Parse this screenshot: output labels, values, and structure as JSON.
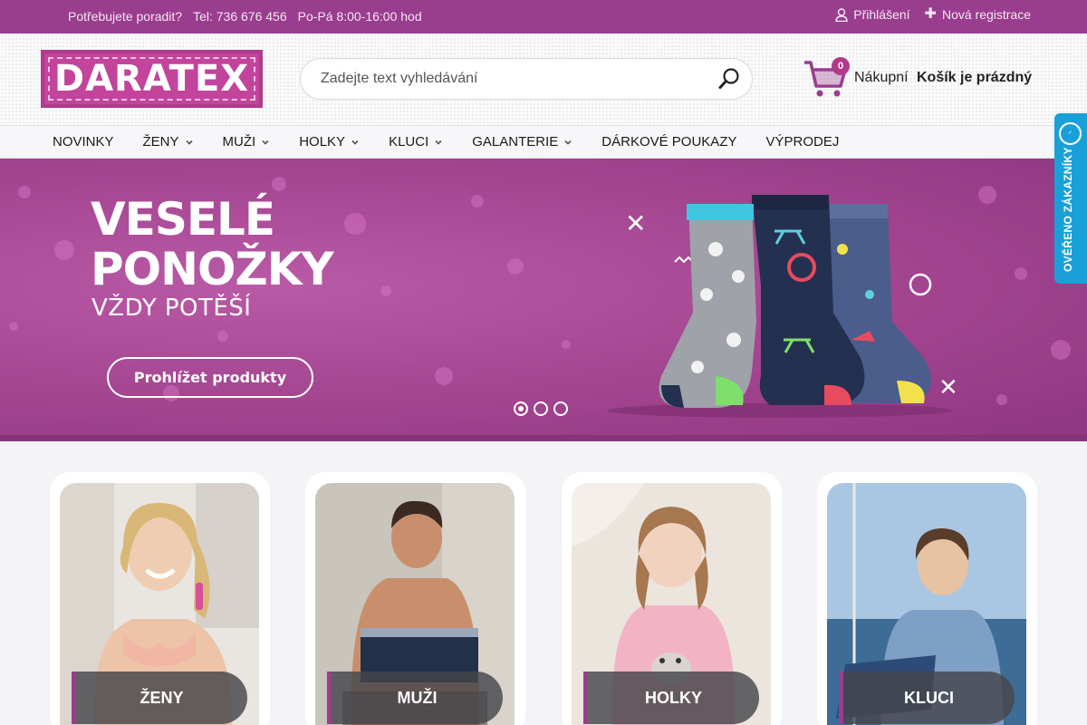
{
  "topbar": {
    "help_label": "Potřebujete poradit?",
    "phone": "Tel: 736 676 456",
    "hours": "Po-Pá 8:00-16:00 hod",
    "login": "Přihlášení",
    "register": "Nová registrace"
  },
  "header": {
    "logo_text": "DARATEX",
    "search_placeholder": "Zadejte text vyhledávání",
    "cart_count": "0",
    "cart_label": "Nákupní",
    "cart_status": "Košík je prázdný"
  },
  "nav": {
    "items": [
      {
        "label": "NOVINKY",
        "dropdown": false
      },
      {
        "label": "ŽENY",
        "dropdown": true
      },
      {
        "label": "MUŽI",
        "dropdown": true
      },
      {
        "label": "HOLKY",
        "dropdown": true
      },
      {
        "label": "KLUCI",
        "dropdown": true
      },
      {
        "label": "GALANTERIE",
        "dropdown": true
      },
      {
        "label": "DÁRKOVÉ POUKAZY",
        "dropdown": false
      },
      {
        "label": "VÝPRODEJ",
        "dropdown": false
      }
    ]
  },
  "verified_badge": "OVĚŘENO ZÁKAZNÍKY",
  "banner": {
    "line1": "VESELÉ",
    "line2": "PONOŽKY",
    "line3": "VŽDY POTĚŠÍ",
    "cta": "Prohlížet produkty",
    "slides": 3,
    "active_slide": 1
  },
  "categories": [
    {
      "label": "ŽENY"
    },
    {
      "label": "MUŽI"
    },
    {
      "label": "HOLKY"
    },
    {
      "label": "KLUCI"
    }
  ],
  "colors": {
    "brand": "#9a3d8e",
    "banner": "#a3448f",
    "verified": "#1aa0d8"
  }
}
